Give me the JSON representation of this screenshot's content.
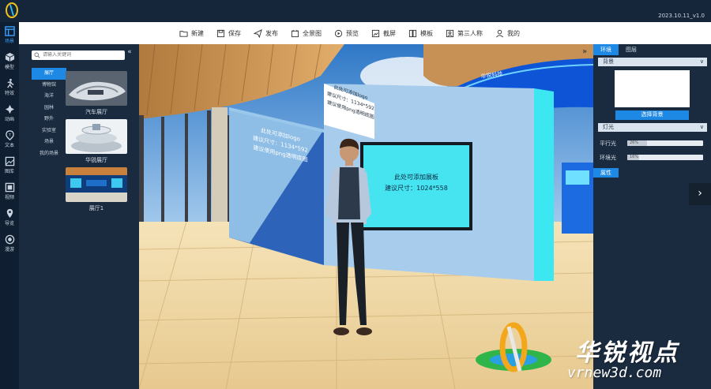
{
  "app": {
    "version": "2023.10.11_v1.0"
  },
  "toolbar": {
    "items": [
      {
        "label": "新建",
        "icon": "folder-icon"
      },
      {
        "label": "保存",
        "icon": "save-icon"
      },
      {
        "label": "发布",
        "icon": "send-icon"
      },
      {
        "label": "全景图",
        "icon": "panorama-icon"
      },
      {
        "label": "预览",
        "icon": "play-icon"
      },
      {
        "label": "截屏",
        "icon": "screenshot-icon"
      },
      {
        "label": "模板",
        "icon": "template-icon"
      },
      {
        "label": "第三人称",
        "icon": "third-person-icon"
      },
      {
        "label": "我的",
        "icon": "user-icon"
      }
    ]
  },
  "rail": {
    "items": [
      {
        "label": "场景",
        "icon": "scene-icon",
        "active": true
      },
      {
        "label": "模型",
        "icon": "cube-icon"
      },
      {
        "label": "特效",
        "icon": "effects-icon"
      },
      {
        "label": "动画",
        "icon": "animation-icon"
      },
      {
        "label": "文本",
        "icon": "text-icon"
      },
      {
        "label": "图库",
        "icon": "gallery-icon"
      },
      {
        "label": "视频",
        "icon": "video-icon"
      },
      {
        "label": "导览",
        "icon": "guide-icon"
      },
      {
        "label": "漫游",
        "icon": "roam-icon"
      }
    ]
  },
  "catpanel": {
    "search_placeholder": "请输入关键词",
    "categories": [
      "展厅",
      "博物馆",
      "海洋",
      "园林",
      "野外",
      "实验室",
      "场景",
      "我的场景"
    ],
    "cards": [
      {
        "label": "汽车展厅"
      },
      {
        "label": "华锐展厅"
      },
      {
        "label": "展厅1"
      }
    ]
  },
  "scene": {
    "board_left_lines": [
      "此处可添加logo",
      "建议尺寸：1134*592",
      "建议使用png透明底图"
    ],
    "board_top_lines": [
      "此处可添加logo",
      "建议尺寸：1134*592",
      "建议使用png透明底图"
    ],
    "screen_lines": [
      "此处可添加展板",
      "建议尺寸：1024*558"
    ],
    "banner_text": "华锐科技"
  },
  "rpanel": {
    "tabs": [
      "环境",
      "图层"
    ],
    "background_title": "背景",
    "select_bg_label": "选择背景",
    "lighting_title": "灯光",
    "parallel_light_label": "平行光",
    "parallel_light_value": "26%",
    "parallel_light_fraction": 0.26,
    "ambient_light_label": "环境光",
    "ambient_light_value": "16%",
    "ambient_light_fraction": 0.16,
    "attributes_label": "属性"
  },
  "watermark": {
    "title": "华锐视点",
    "url": "vrnew3d.com"
  },
  "colors": {
    "accent": "#1e88e5",
    "panel": "#1b2b3f",
    "rail": "#0f1e30",
    "screen": "#46e4f0"
  }
}
